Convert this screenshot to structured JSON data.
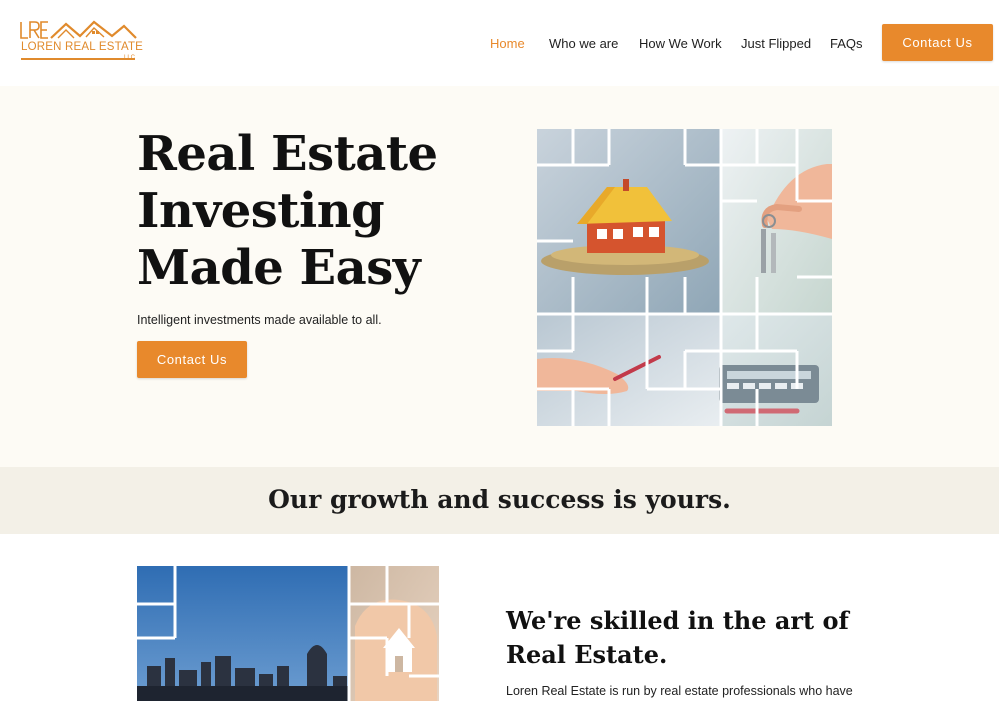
{
  "brand": {
    "logo_text": "LOREN REAL ESTATE",
    "logo_suffix": "LLC",
    "accent_color": "#e8892c"
  },
  "nav": {
    "items": [
      {
        "label": "Home",
        "active": true
      },
      {
        "label": "Who we are",
        "active": false
      },
      {
        "label": "How We Work",
        "active": false
      },
      {
        "label": "Just Flipped",
        "active": false
      },
      {
        "label": "FAQs",
        "active": false
      }
    ],
    "cta_label": "Contact Us"
  },
  "hero": {
    "title_lines": [
      "Real Estate",
      "Investing",
      "Made Easy"
    ],
    "subtitle": "Intelligent investments made available to all.",
    "cta_label": "Contact Us",
    "image_icons": [
      "house-icon",
      "keys-icon",
      "calculator-icon"
    ]
  },
  "band": {
    "text": "Our growth and success is yours."
  },
  "about": {
    "title_lines": [
      "We're skilled in the art of",
      "Real Estate."
    ],
    "body": "Loren Real Estate is run by real estate professionals who have",
    "image_icons": [
      "city-skyline-icon",
      "hands-house-icon"
    ]
  }
}
